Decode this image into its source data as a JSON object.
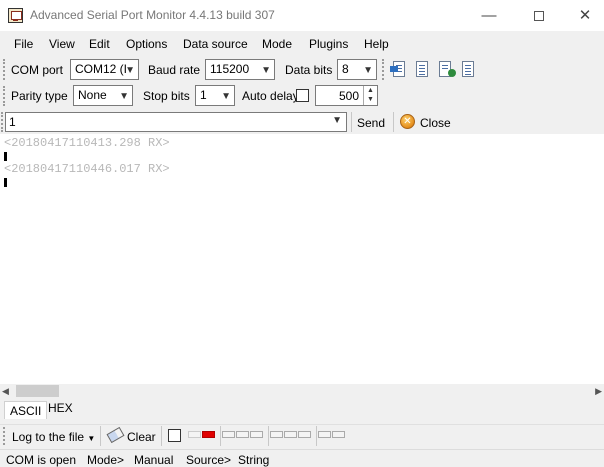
{
  "window": {
    "title": "Advanced Serial Port Monitor 4.4.13 build 307",
    "controls": {
      "minimize": "—",
      "close": "✕"
    }
  },
  "menu": [
    "File",
    "View",
    "Edit",
    "Options",
    "Data source",
    "Mode",
    "Plugins",
    "Help"
  ],
  "port_settings": {
    "com_port_label": "COM port",
    "com_port_value": "COM12 (I",
    "baud_rate_label": "Baud rate",
    "baud_rate_value": "115200",
    "data_bits_label": "Data bits",
    "data_bits_value": "8",
    "parity_label": "Parity type",
    "parity_value": "None",
    "stop_bits_label": "Stop bits",
    "stop_bits_value": "1",
    "auto_delay_label": "Auto delay",
    "auto_delay_checked": false,
    "delay_value": "500"
  },
  "toolbar_icons": [
    "port-settings-icon",
    "view-data-icon",
    "exchange-icon",
    "document-icon"
  ],
  "send": {
    "input_value": "1",
    "send_label": "Send",
    "close_label": "Close"
  },
  "terminal": {
    "lines": [
      "<20180417110413.298 RX>",
      "<20180417110446.017 RX>"
    ]
  },
  "tabs": [
    "ASCII",
    "HEX"
  ],
  "log": {
    "log_to_file_label": "Log to the file",
    "clear_label": "Clear"
  },
  "status": {
    "port_state": "COM is open",
    "mode_label": "Mode>",
    "mode_value": "Manual",
    "source_label": "Source>",
    "source_value": "String"
  },
  "colors": {
    "led_active": "#e00000",
    "timestamp_text": "#b8b8b8"
  }
}
